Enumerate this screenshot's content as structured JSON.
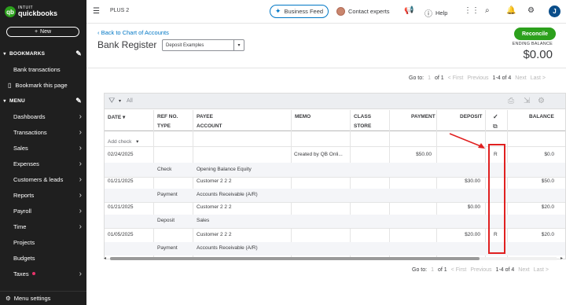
{
  "sidebar": {
    "logo_intuit": "INTUIT",
    "logo_brand": "quickbooks",
    "new_label": "New",
    "bookmarks_header": "BOOKMARKS",
    "bookmark_items": [
      "Bank transactions",
      "Bookmark this page"
    ],
    "menu_header": "MENU",
    "menu_items": [
      "Dashboards",
      "Transactions",
      "Sales",
      "Expenses",
      "Customers & leads",
      "Reports",
      "Payroll",
      "Time",
      "Projects",
      "Budgets",
      "Taxes"
    ],
    "menu_settings": "Menu settings"
  },
  "topbar": {
    "plan": "PLUS 2",
    "business_feed": "Business Feed",
    "contact_experts": "Contact experts",
    "help": "Help",
    "avatar_initial": "J"
  },
  "header": {
    "back_link": "Back to Chart of Accounts",
    "title": "Bank Register",
    "account": "Deposit Examples",
    "reconcile": "Reconcile",
    "ending_balance_label": "ENDING BALANCE",
    "ending_balance_value": "$0.00"
  },
  "pager": {
    "goto": "Go to:",
    "page": "1",
    "of": "of 1",
    "first": "< First",
    "previous": "Previous",
    "range": "1-4 of 4",
    "next": "Next",
    "last": "Last >"
  },
  "table": {
    "filter_all": "All",
    "headers": {
      "date": "DATE",
      "ref": "REF NO.",
      "type": "TYPE",
      "payee": "PAYEE",
      "account": "ACCOUNT",
      "memo": "MEMO",
      "class": "CLASS",
      "store": "STORE",
      "payment": "PAYMENT",
      "deposit": "DEPOSIT",
      "check": "✓",
      "balance": "BALANCE"
    },
    "add_check": "Add check",
    "rows": [
      {
        "date": "02/24/2025",
        "type": "Check",
        "payee": "",
        "account": "Opening Balance Equity",
        "memo": "Created by QB Onli...",
        "payment": "$50.00",
        "deposit": "",
        "status": "R",
        "balance": "$0.0"
      },
      {
        "date": "01/21/2025",
        "type": "Payment",
        "payee": "Customer 2 2 2",
        "account": "Accounts Receivable (A/R)",
        "memo": "",
        "payment": "",
        "deposit": "$30.00",
        "status": "",
        "balance": "$50.0"
      },
      {
        "date": "01/21/2025",
        "type": "Deposit",
        "payee": "Customer 2 2 2",
        "account": "Sales",
        "memo": "",
        "payment": "",
        "deposit": "$0.00",
        "status": "",
        "balance": "$20.0"
      },
      {
        "date": "01/05/2025",
        "type": "Payment",
        "payee": "Customer 2 2 2",
        "account": "Accounts Receivable (A/R)",
        "memo": "",
        "payment": "",
        "deposit": "$20.00",
        "status": "R",
        "balance": "$20.0"
      }
    ]
  },
  "colors": {
    "sidebar_bg": "#1f1f1f",
    "accent_green": "#2ca01c",
    "link_blue": "#0077c5",
    "annotation_red": "#e02020"
  }
}
